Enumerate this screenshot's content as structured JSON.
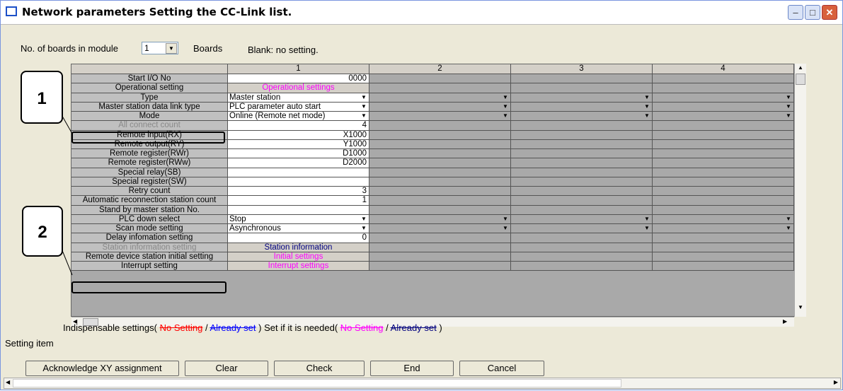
{
  "window": {
    "title": "Network parameters  Setting the CC-Link list."
  },
  "boards": {
    "label": "No. of boards in module",
    "value": "1",
    "suffix": "Boards",
    "blank_note": "Blank: no setting."
  },
  "columns": [
    "1",
    "2",
    "3",
    "4"
  ],
  "rows": [
    {
      "label": "Start I/O No",
      "v1": "0000"
    },
    {
      "label": "Operational setting",
      "v1": "Operational settings"
    },
    {
      "label": "Type",
      "v1": "Master station"
    },
    {
      "label": "Master station data link type",
      "v1": "PLC parameter auto start"
    },
    {
      "label": "Mode",
      "v1": "Online (Remote net mode)"
    },
    {
      "label": "All connect count",
      "v1": "4"
    },
    {
      "label": "Remote input(RX)",
      "v1": "X1000"
    },
    {
      "label": "Remote output(RY)",
      "v1": "Y1000"
    },
    {
      "label": "Remote register(RWr)",
      "v1": "D1000"
    },
    {
      "label": "Remote register(RWw)",
      "v1": "D2000"
    },
    {
      "label": "Special relay(SB)",
      "v1": ""
    },
    {
      "label": "Special register(SW)",
      "v1": ""
    },
    {
      "label": "Retry count",
      "v1": "3"
    },
    {
      "label": "Automatic reconnection station count",
      "v1": "1"
    },
    {
      "label": "Stand by master station No.",
      "v1": ""
    },
    {
      "label": "PLC down select",
      "v1": "Stop"
    },
    {
      "label": "Scan mode setting",
      "v1": "Asynchronous"
    },
    {
      "label": "Delay infomation setting",
      "v1": "0"
    },
    {
      "label": "Station information setting",
      "v1": "Station information"
    },
    {
      "label": "Remote device station initial setting",
      "v1": "Initial settings"
    },
    {
      "label": "Interrupt setting",
      "v1": "Interrupt settings"
    }
  ],
  "callouts": [
    "1",
    "2"
  ],
  "legend": {
    "indispensable": "Indispensable settings(",
    "no_setting": "No Setting",
    "sep": "/",
    "already": "Already set",
    "close": ")",
    "if_needed": "Set if it is needed(",
    "no_setting2": "No Setting",
    "sep2": "/",
    "already2": "Already set",
    "close2": ")"
  },
  "setting_item": "Setting item",
  "buttons": {
    "ack": "Acknowledge XY assignment",
    "clear": "Clear",
    "check": "Check",
    "end": "End",
    "cancel": "Cancel"
  },
  "colors": {
    "magenta": "#ff00ff",
    "navy": "#000080",
    "red": "#ff0000",
    "blue": "#0000ff"
  }
}
